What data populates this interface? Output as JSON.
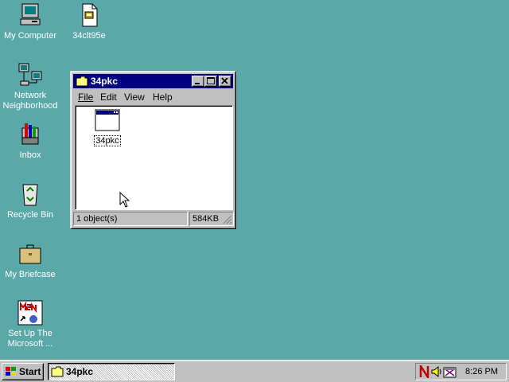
{
  "desktop": {
    "icons": [
      {
        "label": "My Computer",
        "icon": "computer-icon"
      },
      {
        "label": "34clt95e",
        "icon": "document-icon"
      },
      {
        "label_line1": "Network",
        "label_line2": "Neighborhood",
        "icon": "network-icon"
      },
      {
        "label": "Inbox",
        "icon": "inbox-icon"
      },
      {
        "label": "Recycle Bin",
        "icon": "recycle-bin-icon"
      },
      {
        "label": "My Briefcase",
        "icon": "briefcase-icon"
      },
      {
        "label_line1": "Set Up The",
        "label_line2": "Microsoft ...",
        "icon": "msn-icon"
      }
    ]
  },
  "window": {
    "title": "34pkc",
    "menu": [
      "File",
      "Edit",
      "View",
      "Help"
    ],
    "file": {
      "label": "34pkc",
      "icon": "application-icon"
    },
    "status": {
      "count": "1 object(s)",
      "size": "584KB"
    }
  },
  "taskbar": {
    "start_label": "Start",
    "task_label": "34pkc",
    "clock": "8:26 PM"
  },
  "colors": {
    "desktop": "#5aa8a8",
    "titlebar": "#000080",
    "face": "#c0c0c0"
  }
}
